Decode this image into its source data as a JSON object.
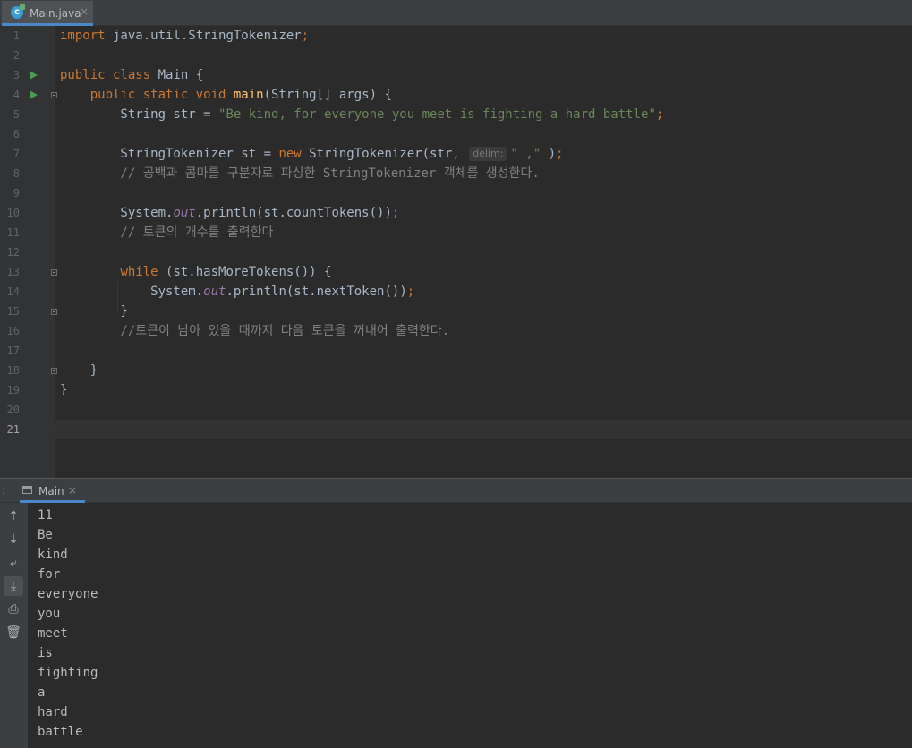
{
  "editor_tab": {
    "file_name": "Main.java",
    "icon": "java-class-icon",
    "close": "×"
  },
  "code_lines": [
    {
      "num": "1",
      "tokens": [
        {
          "t": "import",
          "c": "kw"
        },
        {
          "t": " java.util.StringTokenizer"
        },
        {
          "t": ";",
          "c": "kw"
        }
      ]
    },
    {
      "num": "2",
      "tokens": []
    },
    {
      "num": "3",
      "tokens": [
        {
          "t": "public class",
          "c": "kw"
        },
        {
          "t": " Main {"
        }
      ]
    },
    {
      "num": "4",
      "tokens": [
        {
          "t": "    "
        },
        {
          "t": "public static void",
          "c": "kw"
        },
        {
          "t": " "
        },
        {
          "t": "main",
          "c": "fn"
        },
        {
          "t": "(String[] args) {"
        }
      ]
    },
    {
      "num": "5",
      "tokens": [
        {
          "t": "        String str = "
        },
        {
          "t": "\"Be kind, for everyone you meet is fighting a hard battle\"",
          "c": "str"
        },
        {
          "t": ";",
          "c": "kw"
        }
      ]
    },
    {
      "num": "6",
      "tokens": []
    },
    {
      "num": "7",
      "tokens": [
        {
          "t": "        StringTokenizer st = "
        },
        {
          "t": "new",
          "c": "kw"
        },
        {
          "t": " StringTokenizer(str"
        },
        {
          "t": ",",
          "c": "kw"
        },
        {
          "t": " "
        },
        {
          "t": "delim:",
          "c": "hint"
        },
        {
          "t": "\" ,\"",
          "c": "str"
        },
        {
          "t": " )"
        },
        {
          "t": ";",
          "c": "kw"
        }
      ]
    },
    {
      "num": "8",
      "tokens": [
        {
          "t": "        // 공백과 콤마를 구분자로 파싱한 StringTokenizer 객체를 생성한다.",
          "c": "cm"
        }
      ]
    },
    {
      "num": "9",
      "tokens": []
    },
    {
      "num": "10",
      "tokens": [
        {
          "t": "        System."
        },
        {
          "t": "out",
          "c": "fld"
        },
        {
          "t": ".println(st.countTokens())"
        },
        {
          "t": ";",
          "c": "kw"
        }
      ]
    },
    {
      "num": "11",
      "tokens": [
        {
          "t": "        // 토큰의 개수를 출력한다",
          "c": "cm"
        }
      ]
    },
    {
      "num": "12",
      "tokens": []
    },
    {
      "num": "13",
      "tokens": [
        {
          "t": "        "
        },
        {
          "t": "while",
          "c": "kw"
        },
        {
          "t": " (st.hasMoreTokens()) {"
        }
      ]
    },
    {
      "num": "14",
      "tokens": [
        {
          "t": "            System."
        },
        {
          "t": "out",
          "c": "fld"
        },
        {
          "t": ".println(st.nextToken())"
        },
        {
          "t": ";",
          "c": "kw"
        }
      ]
    },
    {
      "num": "15",
      "tokens": [
        {
          "t": "        }"
        }
      ]
    },
    {
      "num": "16",
      "tokens": [
        {
          "t": "        //토큰이 남아 있을 때까지 다음 토큰을 꺼내어 출력한다.",
          "c": "cm"
        }
      ]
    },
    {
      "num": "17",
      "tokens": []
    },
    {
      "num": "18",
      "tokens": [
        {
          "t": "    }"
        }
      ]
    },
    {
      "num": "19",
      "tokens": [
        {
          "t": "}"
        }
      ]
    },
    {
      "num": "20",
      "tokens": []
    },
    {
      "num": "21",
      "tokens": []
    }
  ],
  "current_line": "21",
  "run_tab": {
    "label": "Main",
    "close": "×"
  },
  "console_output": [
    "11",
    "Be",
    "kind",
    "for",
    "everyone",
    "you",
    "meet",
    "is",
    "fighting",
    "a",
    "hard",
    "battle"
  ],
  "toolbar_icons": [
    "arrow-up-icon",
    "arrow-down-icon",
    "soft-wrap-icon",
    "scroll-to-end-icon",
    "print-icon",
    "trash-icon"
  ],
  "colors": {
    "keyword": "#cc7832",
    "string": "#6a8759",
    "comment": "#808080",
    "method": "#ffc66d",
    "field": "#9876aa",
    "run_arrow": "#499c54",
    "accent": "#4a88c7"
  }
}
